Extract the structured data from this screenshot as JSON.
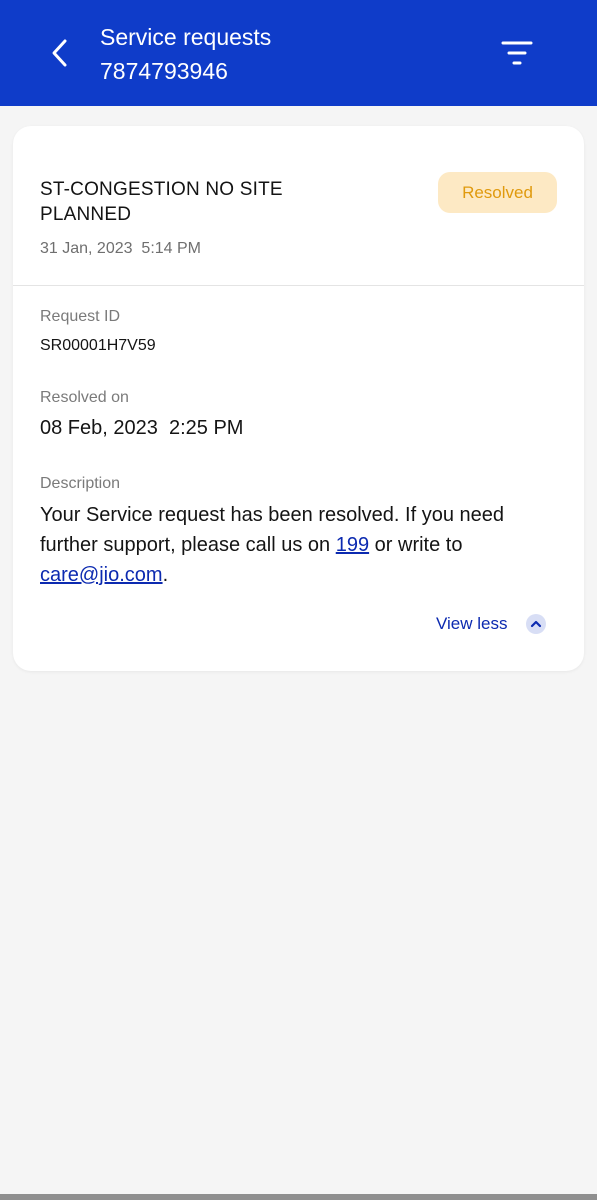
{
  "header": {
    "title": "Service requests",
    "phone": "7874793946",
    "back_icon": "chevron-left-icon",
    "filter_icon": "filter-icon",
    "color": "#0f3cc9"
  },
  "request": {
    "title": "ST-CONGESTION NO SITE PLANNED",
    "created": "31 Jan, 2023  5:14 PM",
    "status": "Resolved",
    "status_bg": "#fde9c4",
    "status_color": "#e09a0e",
    "id_label": "Request ID",
    "id_value": "SR00001H7V59",
    "resolved_label": "Resolved on",
    "resolved_value": "08 Feb, 2023  2:25 PM",
    "description_label": "Description",
    "description_prefix": "Your Service request has been resolved. If you need further support, please call us on ",
    "phone_link": "199",
    "description_middle": " or write to ",
    "email_link": "care@jio.com",
    "description_suffix": ".",
    "toggle_label": "View less",
    "toggle_icon": "chevron-up-icon",
    "link_color": "#0c2ab0"
  }
}
